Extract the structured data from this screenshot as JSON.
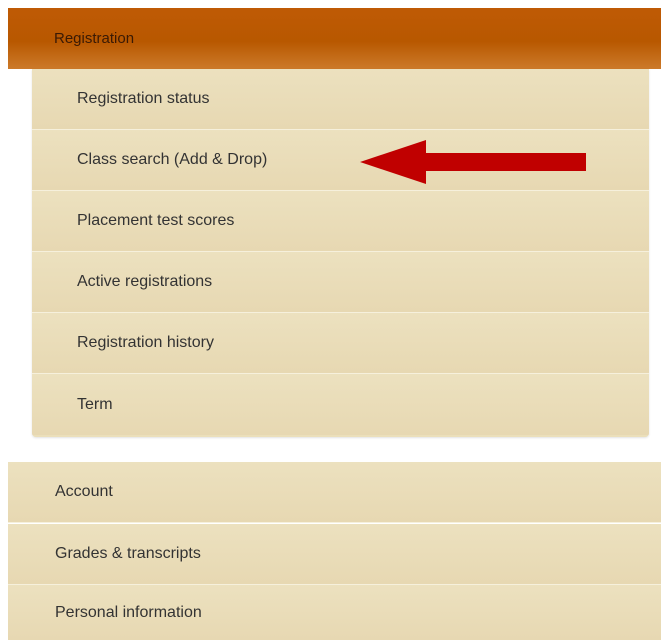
{
  "menu": {
    "section_title": "Registration",
    "submenu_items": [
      {
        "label": "Registration status"
      },
      {
        "label": "Class search (Add & Drop)"
      },
      {
        "label": "Placement test scores"
      },
      {
        "label": "Active registrations"
      },
      {
        "label": "Registration history"
      },
      {
        "label": "Term"
      }
    ],
    "top_items": [
      {
        "label": "Account"
      },
      {
        "label": "Grades & transcripts"
      },
      {
        "label": "Personal information"
      }
    ]
  },
  "annotation": {
    "icon": "left-arrow-icon",
    "color": "#c00000",
    "points_to": "Class search (Add & Drop)"
  },
  "colors": {
    "header": "#bf5a05",
    "item_background": "#e9dcb8"
  }
}
